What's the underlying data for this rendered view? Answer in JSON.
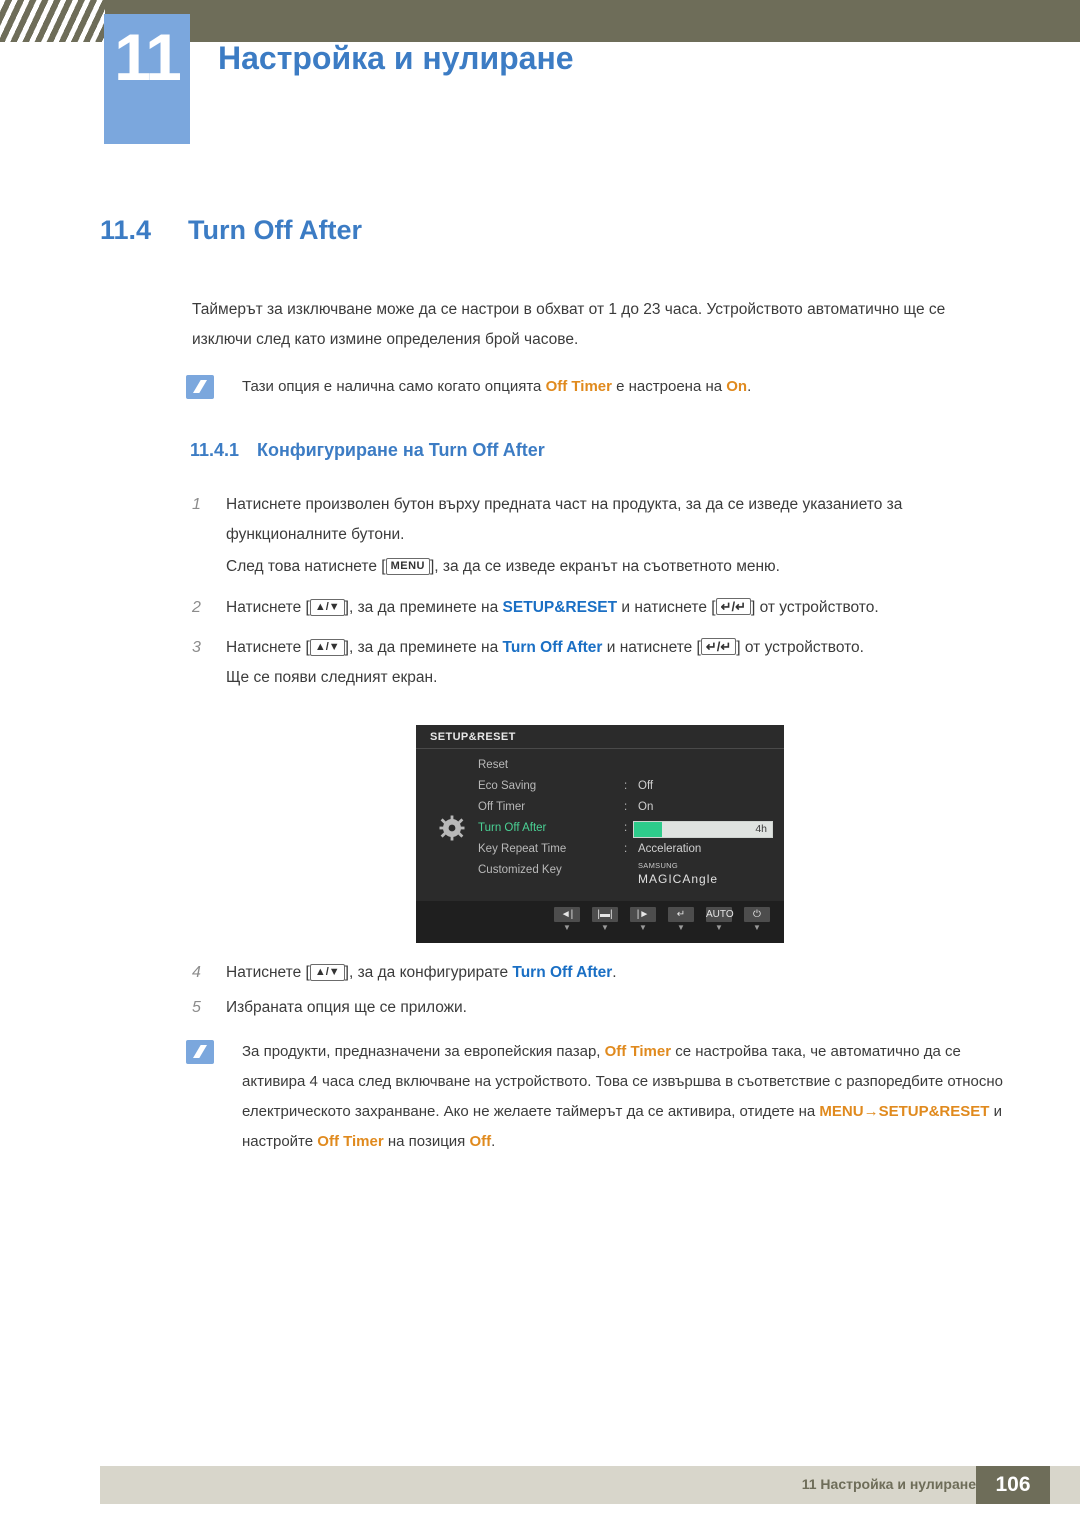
{
  "header": {
    "chapter_number": "11",
    "chapter_title": "Настройка и нулиране"
  },
  "section": {
    "number": "11.4",
    "title": "Turn Off After"
  },
  "intro_paragraph": "Таймерът за изключване може да се настрои в обхват от 1 до 23 часа. Устройството автоматично ще се изключи след като измине определения брой часове.",
  "note_1": {
    "text_before": "Тази опция е налична само когато опцията ",
    "highlight_1": "Off Timer",
    "text_middle": " е настроена на ",
    "highlight_2": "On",
    "text_after": "."
  },
  "subsection": {
    "number": "11.4.1",
    "title_prefix": "Конфигуриране на ",
    "title_highlight": "Turn Off After"
  },
  "steps": {
    "s1_num": "1",
    "s1_text": "Натиснете произволен бутон върху предната част на продукта, за да се изведе указанието за функционалните бутони.",
    "s1b_before": "След това натиснете [",
    "s1b_key": "MENU",
    "s1b_after": "], за да се изведе екранът на съответното меню.",
    "s2_num": "2",
    "s2_before": "Натиснете [",
    "s2_keys": "▲/▼",
    "s2_mid": "], за да преминете на ",
    "s2_target": "SETUP&RESET",
    "s2_mid2": " и натиснете [",
    "s2_keys2": "↵/↵",
    "s2_after": "] от устройството.",
    "s3_num": "3",
    "s3_before": "Натиснете [",
    "s3_keys": "▲/▼",
    "s3_mid": "], за да преминете на ",
    "s3_target": "Turn Off After",
    "s3_mid2": " и натиснете [",
    "s3_keys2": "↵/↵",
    "s3_after": "] от устройството.",
    "s3b_text": "Ще се появи следният екран.",
    "s4_num": "4",
    "s4_before": "Натиснете [",
    "s4_keys": "▲/▼",
    "s4_mid": "], за да конфигурирате ",
    "s4_target": "Turn Off After",
    "s4_after": ".",
    "s5_num": "5",
    "s5_text": "Избраната опция ще се приложи."
  },
  "osd": {
    "title": "SETUP&RESET",
    "rows": [
      {
        "label": "Reset",
        "colon": "",
        "value": ""
      },
      {
        "label": "Eco Saving",
        "colon": ":",
        "value": "Off"
      },
      {
        "label": "Off Timer",
        "colon": ":",
        "value": "On"
      },
      {
        "label": "Turn Off After",
        "colon": ":",
        "value": "4h",
        "selected": true,
        "bar": true,
        "bar_percent": 20
      },
      {
        "label": "Key Repeat Time",
        "colon": ":",
        "value": "Acceleration"
      },
      {
        "label": "Customized Key",
        "colon": "",
        "value_brand": "SAMSUNG",
        "value_magic": "MAGIC",
        "value_suffix": "Angle"
      }
    ],
    "buttons": [
      {
        "cap": "◄|",
        "sub": "▼"
      },
      {
        "cap": "|▬|",
        "sub": "▼"
      },
      {
        "cap": "|►",
        "sub": "▼"
      },
      {
        "cap": "↵",
        "sub": "▼"
      },
      {
        "cap": "AUTO",
        "sub": "▼"
      },
      {
        "cap": "⏻",
        "sub": "▼"
      }
    ]
  },
  "note_2": {
    "line1_a": "За продукти, предназначени за европейския пазар, ",
    "line1_hl": "Off Timer",
    "line1_b": " се настройва така, че автоматично",
    "line2": "да се активира 4 часа след включване на устройството. Това се извършва в съответствие с",
    "line3": "разпоредбите относно електрическото захранване. Ако не желаете таймерът да се активира,",
    "line4_a": "отидете на ",
    "line4_hl1": "MENU",
    "line4_arrow": "→",
    "line4_hl2": "SETUP&RESET",
    "line4_b": " и настройте ",
    "line4_hl3": "Off Timer",
    "line4_c": " на позиция ",
    "line4_hl4": "Off",
    "line4_d": "."
  },
  "footer": {
    "text": "11 Настройка и нулиране",
    "page": "106"
  },
  "colors": {
    "header_bar": "#6e6d59",
    "badge": "#7ba7dd",
    "heading_blue": "#3c7cc4",
    "highlight_blue": "#1a6fc4",
    "highlight_orange": "#e08a1e",
    "osd_green": "#2ecb8b",
    "footer_bar": "#d8d6cb"
  }
}
